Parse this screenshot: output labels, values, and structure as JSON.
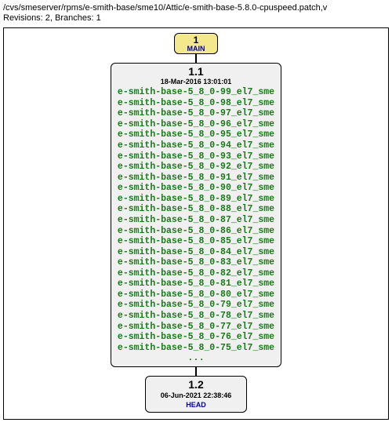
{
  "header": {
    "path": "/cvs/smeserver/rpms/e-smith-base/sme10/Attic/e-smith-base-5.8.0-cpuspeed.patch,v",
    "revisions_line": "Revisions: 2, Branches: 1"
  },
  "branch": {
    "number": "1",
    "name": "MAIN"
  },
  "rev1": {
    "number": "1.1",
    "date": "18-Mar-2016 13:01:01",
    "tags": [
      "e-smith-base-5_8_0-99_el7_sme",
      "e-smith-base-5_8_0-98_el7_sme",
      "e-smith-base-5_8_0-97_el7_sme",
      "e-smith-base-5_8_0-96_el7_sme",
      "e-smith-base-5_8_0-95_el7_sme",
      "e-smith-base-5_8_0-94_el7_sme",
      "e-smith-base-5_8_0-93_el7_sme",
      "e-smith-base-5_8_0-92_el7_sme",
      "e-smith-base-5_8_0-91_el7_sme",
      "e-smith-base-5_8_0-90_el7_sme",
      "e-smith-base-5_8_0-89_el7_sme",
      "e-smith-base-5_8_0-88_el7_sme",
      "e-smith-base-5_8_0-87_el7_sme",
      "e-smith-base-5_8_0-86_el7_sme",
      "e-smith-base-5_8_0-85_el7_sme",
      "e-smith-base-5_8_0-84_el7_sme",
      "e-smith-base-5_8_0-83_el7_sme",
      "e-smith-base-5_8_0-82_el7_sme",
      "e-smith-base-5_8_0-81_el7_sme",
      "e-smith-base-5_8_0-80_el7_sme",
      "e-smith-base-5_8_0-79_el7_sme",
      "e-smith-base-5_8_0-78_el7_sme",
      "e-smith-base-5_8_0-77_el7_sme",
      "e-smith-base-5_8_0-76_el7_sme",
      "e-smith-base-5_8_0-75_el7_sme"
    ],
    "ellipsis": "..."
  },
  "rev2": {
    "number": "1.2",
    "date": "06-Jun-2021 22:38:46",
    "head": "HEAD"
  }
}
